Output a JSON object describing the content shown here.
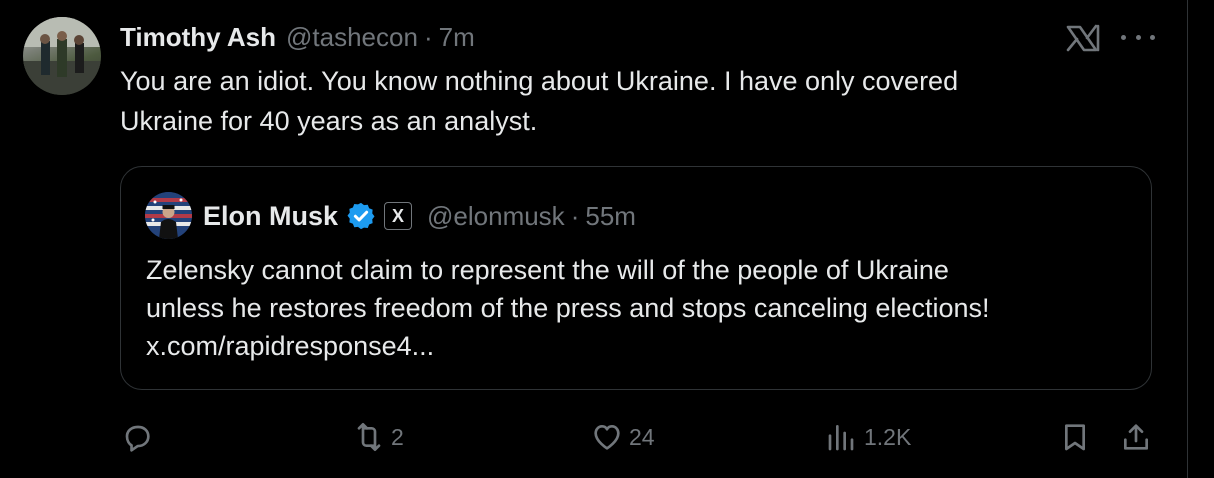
{
  "tweet": {
    "author_name": "Timothy Ash",
    "author_handle": "@tashecon",
    "separator": "·",
    "time": "7m",
    "text_lines": [
      "You are an idiot. You know nothing about Ukraine. I have only covered",
      "Ukraine for 40 years as an analyst."
    ]
  },
  "quoted_tweet": {
    "author_name": "Elon Musk",
    "badge_label": "X",
    "author_handle": "@elonmusk",
    "separator": "·",
    "time": "55m",
    "text_lines": [
      "Zelensky cannot claim to represent the will of the people of Ukraine",
      "unless he restores freedom of the press and stops canceling elections!",
      "x.com/rapidresponse4..."
    ]
  },
  "actions": {
    "reply_count": "",
    "retweet_count": "2",
    "like_count": "24",
    "views_count": "1.2K"
  },
  "icons": {
    "reply": "reply-icon",
    "retweet": "retweet-icon",
    "like": "heart-icon",
    "views": "views-icon",
    "bookmark": "bookmark-icon",
    "share": "share-icon",
    "grok": "grok-icon",
    "more": "more-icon",
    "verified": "verified-icon"
  },
  "colors": {
    "background": "#000000",
    "text": "#e7e9ea",
    "muted": "#71767b",
    "border": "#2f3336",
    "verified": "#1d9bf0"
  }
}
